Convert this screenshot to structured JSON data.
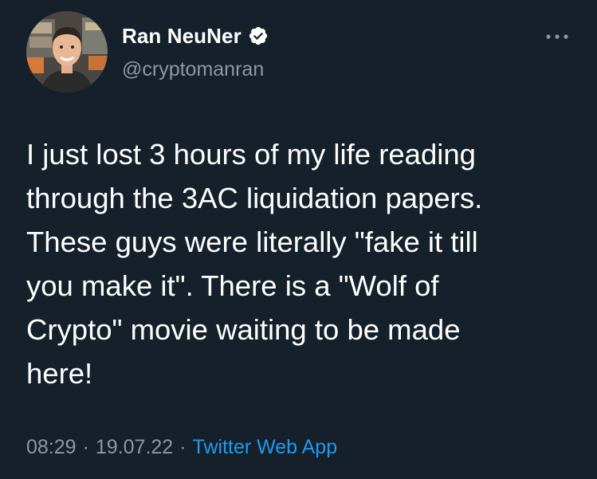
{
  "author": {
    "display_name": "Ran NeuNer",
    "handle": "@cryptomanran",
    "verified_icon": "verified-badge-icon",
    "avatar_icon": "profile-photo"
  },
  "tweet": {
    "text": "I just lost 3 hours of my life reading\nthrough the 3AC liquidation papers.\nThese guys were literally \"fake it till\nyou make it\". There is a \"Wolf of\nCrypto\" movie waiting to be made\nhere!"
  },
  "meta": {
    "time": "08:29",
    "separator_1": "·",
    "date": "19.07.22",
    "separator_2": "·",
    "source": "Twitter Web App"
  },
  "colors": {
    "background": "#15202b",
    "text_primary": "#ffffff",
    "text_secondary": "#8b98a5",
    "accent": "#1d9bf0"
  }
}
